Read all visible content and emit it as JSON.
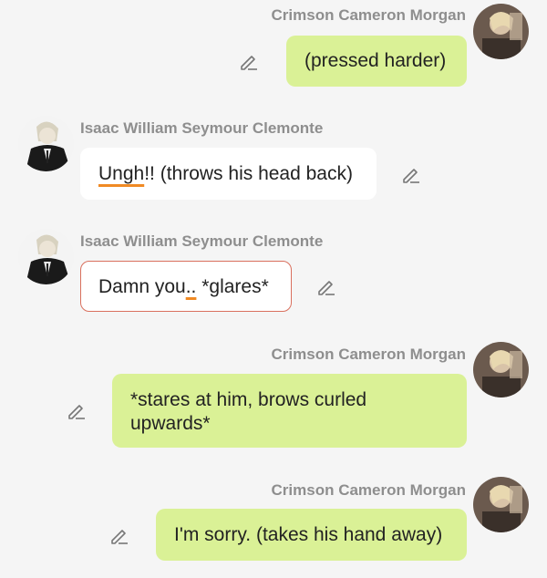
{
  "messages": [
    {
      "sender": "Crimson Cameron Morgan",
      "side": "user",
      "text": "(pressed harder)"
    },
    {
      "sender": "Isaac William Seymour Clemonte",
      "side": "char",
      "text_pre": "",
      "text_spell": "Ungh",
      "text_post": "!! (throws his head back)"
    },
    {
      "sender": "Isaac William Seymour Clemonte",
      "side": "char",
      "text_pre": "Damn you",
      "text_spell": "..",
      "text_post": " *glares*"
    },
    {
      "sender": "Crimson Cameron Morgan",
      "side": "user",
      "text": "*stares at him, brows curled\nupwards*"
    },
    {
      "sender": "Crimson Cameron Morgan",
      "side": "user",
      "text": "I'm sorry. (takes his hand away)"
    }
  ],
  "icons": {
    "edit": "pencil-icon",
    "avatar_user": "user-avatar",
    "avatar_char": "character-avatar"
  },
  "colors": {
    "background": "#f5f5f5",
    "user_bubble": "#daf196",
    "char_bubble": "#ffffff",
    "selected_border": "#d9705e",
    "name_text": "#8e8e8e",
    "spellcheck": "#f08a24"
  }
}
